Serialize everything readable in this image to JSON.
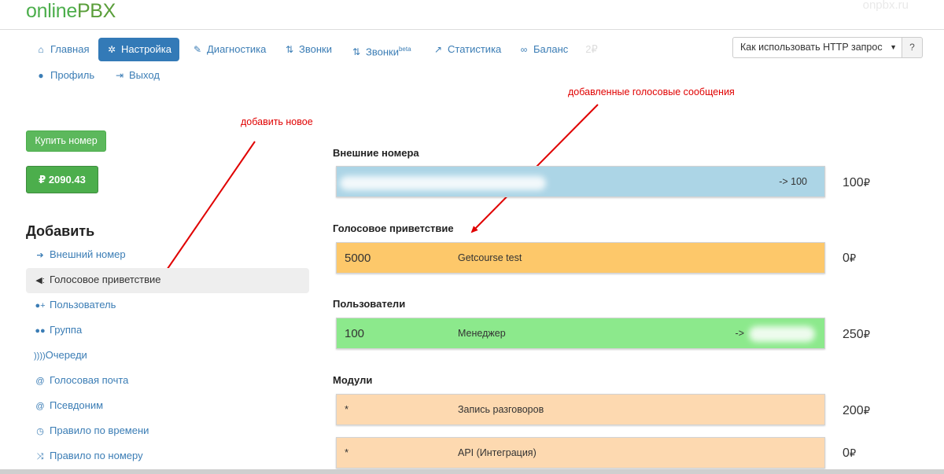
{
  "header": {
    "logo_online": "online",
    "logo_pbx": "PBX",
    "brand_right": "onpbx.ru"
  },
  "nav": {
    "items": [
      {
        "label": "Главная",
        "icon": "home-icon"
      },
      {
        "label": "Настройка",
        "icon": "gear-icon",
        "active": true
      },
      {
        "label": "Диагностика",
        "icon": "wrench-icon"
      },
      {
        "label": "Звонки",
        "icon": "sort-arrows-icon"
      },
      {
        "label": "Звонки",
        "sup": "beta",
        "icon": "sort-arrows-icon"
      },
      {
        "label": "Статистика",
        "icon": "line-chart-icon"
      },
      {
        "label": "Баланс",
        "icon": "link-icon",
        "value": "2₽"
      },
      {
        "label": "Профиль",
        "icon": "user-icon"
      },
      {
        "label": "Выход",
        "icon": "logout-icon"
      }
    ]
  },
  "help": {
    "select_value": "Как использовать HTTP запрос",
    "button_label": "?"
  },
  "annotations": {
    "add_new": "добавить новое",
    "added_voice": "добавленные голосовые сообщения"
  },
  "sidebar": {
    "buy_button": "Купить номер",
    "balance": "₽ 2090.43",
    "add_title": "Добавить",
    "add_items": [
      {
        "label": "Внешний номер",
        "icon": "arrow-right-icon"
      },
      {
        "label": "Голосовое приветствие",
        "icon": "megaphone-icon",
        "active": true
      },
      {
        "label": "Пользователь",
        "icon": "user-plus-icon"
      },
      {
        "label": "Группа",
        "icon": "users-icon"
      },
      {
        "label": "Очереди",
        "icon": "queue-icon"
      },
      {
        "label": "Голосовая почта",
        "icon": "at-icon"
      },
      {
        "label": "Псевдоним",
        "icon": "at-icon"
      },
      {
        "label": "Правило по времени",
        "icon": "history-icon"
      },
      {
        "label": "Правило по номеру",
        "icon": "shuffle-icon"
      }
    ]
  },
  "sections": {
    "external": {
      "title": "Внешние номера",
      "target": "-> 100",
      "price": "100",
      "currency": "₽"
    },
    "greeting": {
      "title": "Голосовое приветствие",
      "number": "5000",
      "name": "Getcourse test",
      "price": "0",
      "currency": "₽"
    },
    "users": {
      "title": "Пользователи",
      "number": "100",
      "name": "Менеджер",
      "target": "->",
      "price": "250",
      "currency": "₽"
    },
    "modules": {
      "title": "Модули",
      "items": [
        {
          "mark": "*",
          "name": "Запись разговоров",
          "price": "200",
          "currency": "₽"
        },
        {
          "mark": "*",
          "name": "API (Интеграция)",
          "price": "0",
          "currency": "₽"
        }
      ]
    }
  },
  "colors": {
    "accent": "#337ab7",
    "green": "#5cb85c",
    "annotation": "#e00000",
    "card_blue": "#acd5e6",
    "card_orange": "#fdc86a",
    "card_green": "#8ce98c",
    "card_peach": "#fdd9b0"
  }
}
